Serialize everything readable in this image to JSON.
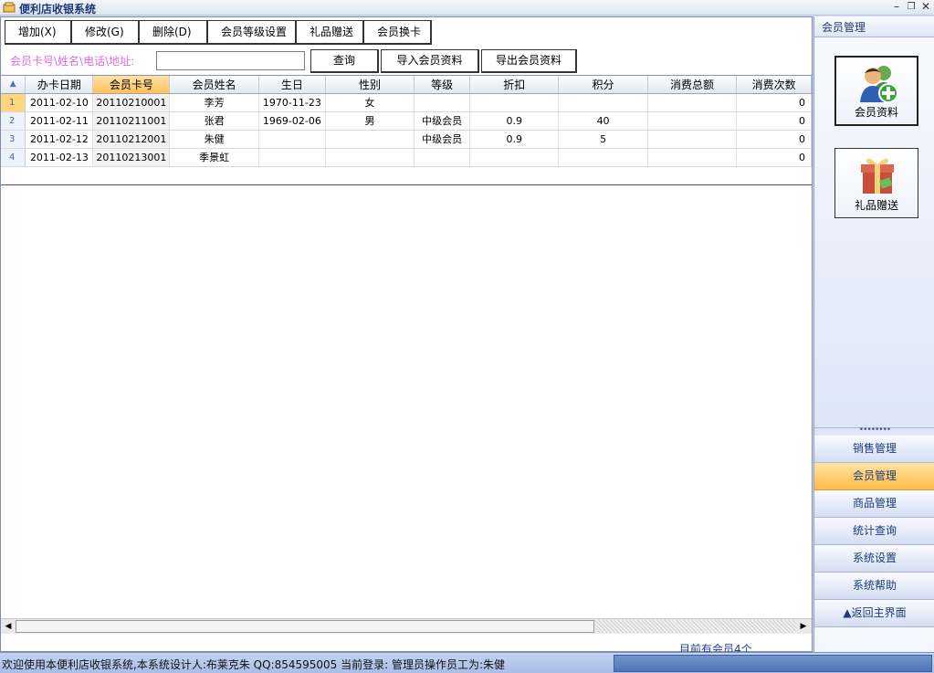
{
  "window": {
    "title": "便利店收银系统",
    "controls": [
      "–",
      "❐",
      "✕"
    ]
  },
  "toolbar": {
    "buttons": [
      {
        "label": "增加(X)"
      },
      {
        "label": "修改(G)"
      },
      {
        "label": "删除(D)"
      },
      {
        "label": "会员等级设置"
      },
      {
        "label": "礼品赠送"
      },
      {
        "label": "会员换卡"
      }
    ]
  },
  "search": {
    "label": "会员卡号\\姓名\\电话\\地址:",
    "value": "",
    "query_button": "查询",
    "import_button": "导入会员资料",
    "export_button": "导出会员资料"
  },
  "grid": {
    "corner_icon": "▲",
    "columns": [
      "办卡日期",
      "会员卡号",
      "会员姓名",
      "生日",
      "性别",
      "等级",
      "折扣",
      "积分",
      "消费总额",
      "消费次数"
    ],
    "active_column": 1,
    "rows": [
      {
        "num": "1",
        "date": "2011-02-10",
        "card": "20110210001",
        "name": "李芳",
        "birthday": "1970-11-23",
        "gender": "女",
        "level": "",
        "discount": "",
        "points": "",
        "total": "",
        "count": "0"
      },
      {
        "num": "2",
        "date": "2011-02-11",
        "card": "20110211001",
        "name": "张君",
        "birthday": "1969-02-06",
        "gender": "男",
        "level": "中级会员",
        "discount": "0.9",
        "points": "40",
        "total": "",
        "count": "0"
      },
      {
        "num": "3",
        "date": "2011-02-12",
        "card": "20110212001",
        "name": "朱健",
        "birthday": "",
        "gender": "",
        "level": "中级会员",
        "discount": "0.9",
        "points": "5",
        "total": "",
        "count": "0"
      },
      {
        "num": "4",
        "date": "2011-02-13",
        "card": "20110213001",
        "name": "季景虹",
        "birthday": "",
        "gender": "",
        "level": "",
        "discount": "",
        "points": "",
        "total": "",
        "count": "0"
      }
    ]
  },
  "footer": {
    "count_text": "目前有会员4个"
  },
  "sidepanel": {
    "header": "会员管理",
    "buttons": [
      {
        "label": "会员资料",
        "icon": "member-add-icon"
      },
      {
        "label": "礼品赠送",
        "icon": "gift-icon"
      }
    ],
    "splitter": "••••••••",
    "nav": [
      {
        "label": "销售管理"
      },
      {
        "label": "会员管理"
      },
      {
        "label": "商品管理"
      },
      {
        "label": "统计查询"
      },
      {
        "label": "系统设置"
      },
      {
        "label": "系统帮助"
      },
      {
        "label": "▲返回主界面"
      }
    ],
    "active_nav": 1
  },
  "statusbar": {
    "text": "欢迎使用本便利店收银系统,本系统设计人:布莱克朱  QQ:854595005 当前登录: 管理员操作员工为:朱健"
  },
  "colors": {
    "accent": "#ffc15a",
    "search_label": "#e06cd8",
    "nav_text": "#1d3b78"
  }
}
